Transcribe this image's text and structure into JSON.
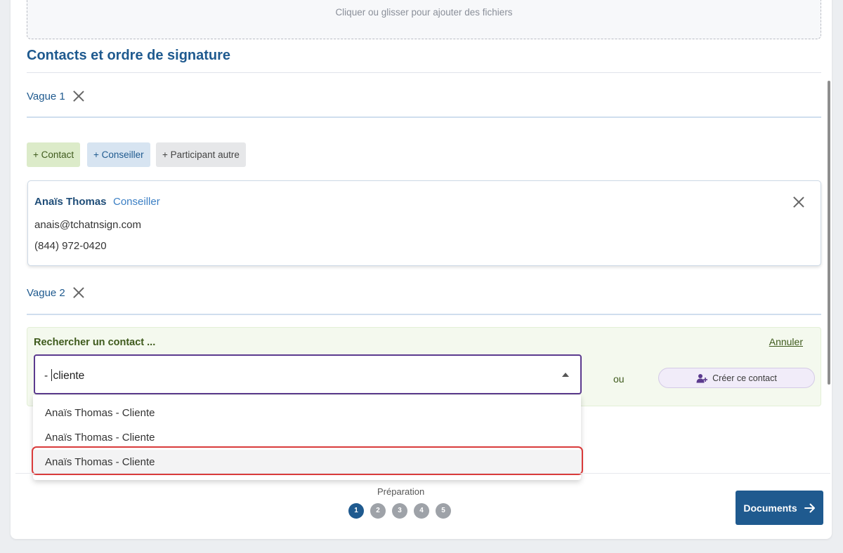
{
  "dropzone": {
    "text": "Cliquer ou glisser pour ajouter des fichiers"
  },
  "section": {
    "title": "Contacts et ordre de signature"
  },
  "waves": [
    {
      "label": "Vague 1"
    },
    {
      "label": "Vague 2"
    }
  ],
  "add_buttons": {
    "contact": "+ Contact",
    "conseiller": "+ Conseiller",
    "autre": "+ Participant autre"
  },
  "participant": {
    "name": "Anaïs Thomas",
    "role": "Conseiller",
    "email": "anais@tchatnsign.com",
    "phone": "(844) 972-0420"
  },
  "search": {
    "title": "Rechercher un contact ...",
    "cancel": "Annuler",
    "value_before_caret": "- ",
    "value_after_caret": "cliente",
    "or": "ou",
    "create_button": "Créer ce contact"
  },
  "dropdown": {
    "options": [
      "Anaïs Thomas - Cliente",
      "Anaïs Thomas - Cliente",
      "Anaïs Thomas - Cliente"
    ]
  },
  "footer": {
    "step_label": "Préparation",
    "steps": [
      "1",
      "2",
      "3",
      "4",
      "5"
    ],
    "current_step": "1",
    "next_button": "Documents"
  },
  "icons": {
    "close": "close-icon",
    "dropdown": "caret-up-icon",
    "create_contact": "user-plus-icon",
    "next": "arrow-right-icon"
  },
  "colors": {
    "primary": "#1f5a8f",
    "accent_purple": "#5b3a8e",
    "success_green": "#3e5a1c",
    "highlight_red": "#d93b3b"
  }
}
